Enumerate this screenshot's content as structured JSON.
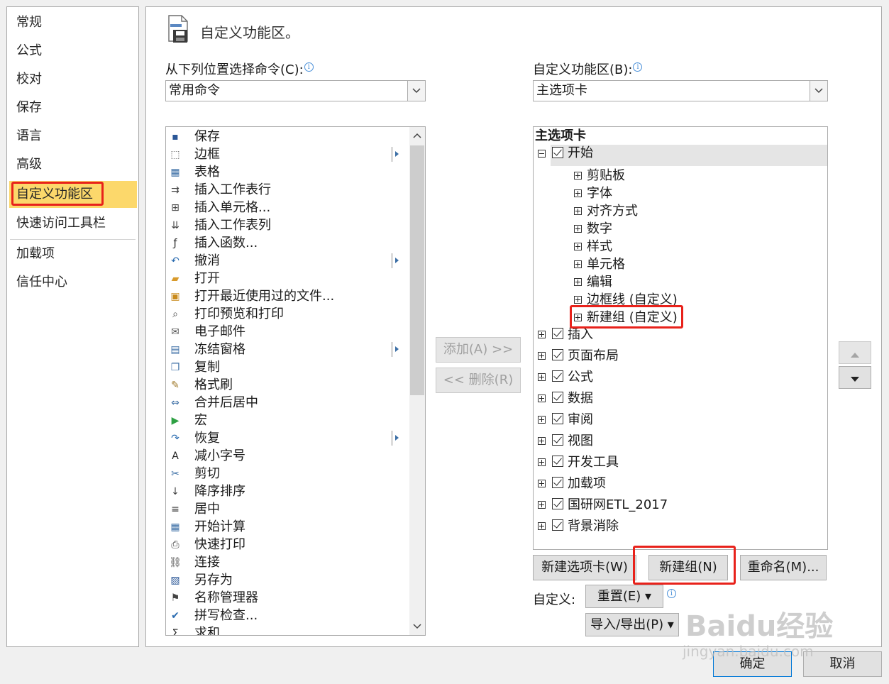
{
  "nav": {
    "items": [
      {
        "label": "常规"
      },
      {
        "label": "公式"
      },
      {
        "label": "校对"
      },
      {
        "label": "保存"
      },
      {
        "label": "语言"
      },
      {
        "label": "高级"
      },
      {
        "label": "自定义功能区"
      },
      {
        "label": "快速访问工具栏"
      },
      {
        "label": "加载项"
      },
      {
        "label": "信任中心"
      }
    ]
  },
  "header": {
    "title": "自定义功能区。",
    "icon": "ribbon-customize-icon"
  },
  "left_panel": {
    "label": "从下列位置选择命令(C):",
    "combo_value": "常用命令",
    "commands": [
      {
        "label": "保存",
        "icon": "save-icon"
      },
      {
        "label": "边框",
        "icon": "border-icon"
      },
      {
        "label": "表格",
        "icon": "table-icon"
      },
      {
        "label": "插入工作表行",
        "icon": "insert-row-icon"
      },
      {
        "label": "插入单元格...",
        "icon": "insert-cell-icon"
      },
      {
        "label": "插入工作表列",
        "icon": "insert-column-icon"
      },
      {
        "label": "插入函数...",
        "icon": "function-icon"
      },
      {
        "label": "撤消",
        "icon": "undo-icon"
      },
      {
        "label": "打开",
        "icon": "open-folder-icon"
      },
      {
        "label": "打开最近使用过的文件...",
        "icon": "recent-files-icon"
      },
      {
        "label": "打印预览和打印",
        "icon": "print-preview-icon"
      },
      {
        "label": "电子邮件",
        "icon": "email-icon"
      },
      {
        "label": "冻结窗格",
        "icon": "freeze-panes-icon"
      },
      {
        "label": "复制",
        "icon": "copy-icon"
      },
      {
        "label": "格式刷",
        "icon": "format-painter-icon"
      },
      {
        "label": "合并后居中",
        "icon": "merge-center-icon"
      },
      {
        "label": "宏",
        "icon": "macro-icon"
      },
      {
        "label": "恢复",
        "icon": "redo-icon"
      },
      {
        "label": "减小字号",
        "icon": "decrease-font-icon"
      },
      {
        "label": "剪切",
        "icon": "cut-icon"
      },
      {
        "label": "降序排序",
        "icon": "sort-desc-icon"
      },
      {
        "label": "居中",
        "icon": "align-center-icon"
      },
      {
        "label": "开始计算",
        "icon": "calculate-icon"
      },
      {
        "label": "快速打印",
        "icon": "quick-print-icon"
      },
      {
        "label": "连接",
        "icon": "connections-icon"
      },
      {
        "label": "另存为",
        "icon": "save-as-icon"
      },
      {
        "label": "名称管理器",
        "icon": "name-manager-icon"
      },
      {
        "label": "拼写检查...",
        "icon": "spell-check-icon"
      },
      {
        "label": "求和",
        "icon": "sum-icon"
      }
    ]
  },
  "middle": {
    "add_label": "添加(A) >>",
    "remove_label": "<< 删除(R)"
  },
  "right_panel": {
    "label": "自定义功能区(B):",
    "combo_value": "主选项卡",
    "tree_header": "主选项卡",
    "home_tab": "开始",
    "home_groups": [
      {
        "label": "剪贴板"
      },
      {
        "label": "字体"
      },
      {
        "label": "对齐方式"
      },
      {
        "label": "数字"
      },
      {
        "label": "样式"
      },
      {
        "label": "单元格"
      },
      {
        "label": "编辑"
      },
      {
        "label": "边框线 (自定义)"
      },
      {
        "label": "新建组 (自定义)"
      }
    ],
    "tabs": [
      {
        "label": "插入"
      },
      {
        "label": "页面布局"
      },
      {
        "label": "公式"
      },
      {
        "label": "数据"
      },
      {
        "label": "审阅"
      },
      {
        "label": "视图"
      },
      {
        "label": "开发工具"
      },
      {
        "label": "加载项"
      },
      {
        "label": "国研网ETL_2017"
      },
      {
        "label": "背景消除"
      }
    ],
    "new_tab_label": "新建选项卡(W)",
    "new_group_label": "新建组(N)",
    "rename_label": "重命名(M)...",
    "customize_label": "自定义:",
    "reset_label": "重置(E) ▾",
    "import_export_label": "导入/导出(P) ▾"
  },
  "footer": {
    "ok_label": "确定",
    "cancel_label": "取消"
  },
  "watermark": {
    "brand": "Baidu经验",
    "url": "jingyan.baidu.com"
  },
  "colors": {
    "selected_nav": "#fcd86b",
    "highlight_box": "#e8221b",
    "tree_selected": "#e5e5e5"
  }
}
